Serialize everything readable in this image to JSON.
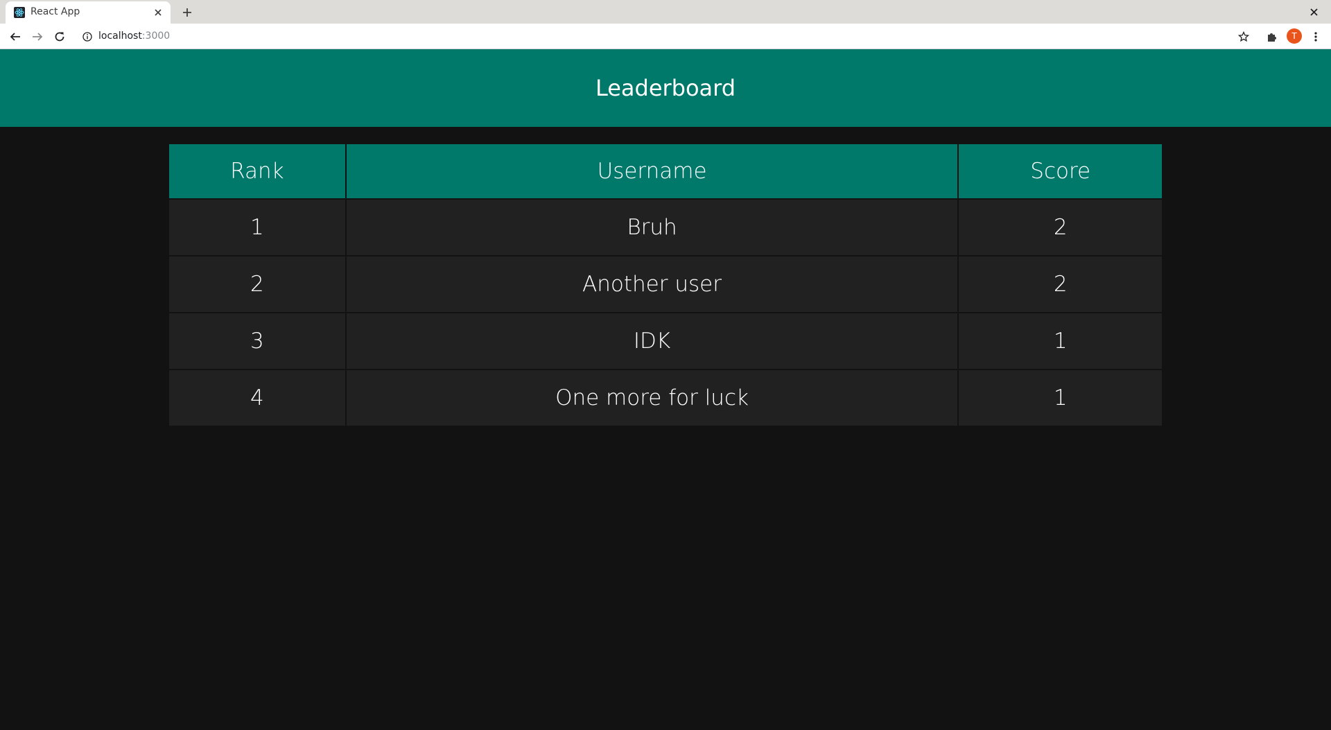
{
  "browser": {
    "tab_title": "React App",
    "url_host": "localhost",
    "url_port": ":3000",
    "avatar_letter": "T"
  },
  "header": {
    "title": "Leaderboard"
  },
  "table": {
    "columns": [
      "Rank",
      "Username",
      "Score"
    ],
    "rows": [
      {
        "rank": "1",
        "username": "Bruh",
        "score": "2"
      },
      {
        "rank": "2",
        "username": "Another user",
        "score": "2"
      },
      {
        "rank": "3",
        "username": "IDK",
        "score": "1"
      },
      {
        "rank": "4",
        "username": "One more for luck",
        "score": "1"
      }
    ]
  },
  "colors": {
    "accent": "#00796b",
    "background": "#121212",
    "row": "#212121",
    "avatar": "#e8541c"
  },
  "icons": [
    "react-favicon-icon",
    "close-icon",
    "plus-icon",
    "back-arrow-icon",
    "forward-arrow-icon",
    "reload-icon",
    "info-icon",
    "star-icon",
    "puzzle-icon",
    "kebab-menu-icon"
  ]
}
